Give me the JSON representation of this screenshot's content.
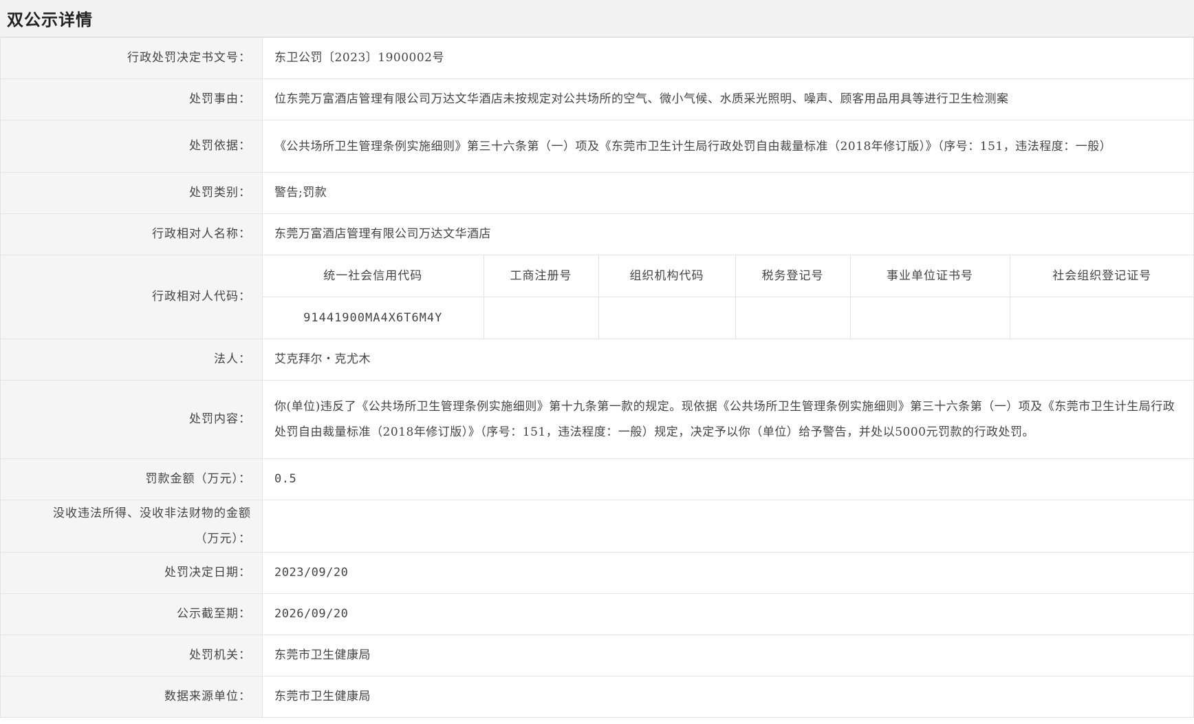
{
  "header": {
    "title": "双公示详情"
  },
  "rows": {
    "doc_no": {
      "label": "行政处罚决定书文号：",
      "value": "东卫公罚〔2023〕1900002号"
    },
    "reason": {
      "label": "处罚事由：",
      "value": "位东莞万富酒店管理有限公司万达文华酒店未按规定对公共场所的空气、微小气候、水质采光照明、噪声、顾客用品用具等进行卫生检测案"
    },
    "basis": {
      "label": "处罚依据：",
      "value": "《公共场所卫生管理条例实施细则》第三十六条第（一）项及《东莞市卫生计生局行政处罚自由裁量标准（2018年修订版）》（序号：151，违法程度：一般）"
    },
    "category": {
      "label": "处罚类别：",
      "value": "警告;罚款"
    },
    "party_name": {
      "label": "行政相对人名称：",
      "value": "东莞万富酒店管理有限公司万达文华酒店"
    },
    "party_code": {
      "label": "行政相对人代码：",
      "headers": [
        "统一社会信用代码",
        "工商注册号",
        "组织机构代码",
        "税务登记号",
        "事业单位证书号",
        "社会组织登记证号"
      ],
      "values": [
        "91441900MA4X6T6M4Y",
        "",
        "",
        "",
        "",
        ""
      ]
    },
    "legal_person": {
      "label": "法人：",
      "value": "艾克拜尔・克尤木"
    },
    "content": {
      "label": "处罚内容：",
      "value": "你(单位)违反了《公共场所卫生管理条例实施细则》第十九条第一款的规定。现依据《公共场所卫生管理条例实施细则》第三十六条第（一）项及《东莞市卫生计生局行政处罚自由裁量标准（2018年修订版）》（序号：151，违法程度：一般）规定，决定予以你（单位）给予警告，并处以5000元罚款的行政处罚。"
    },
    "fine": {
      "label": "罚款金额（万元）：",
      "value": "0.5"
    },
    "confiscation": {
      "label": "没收违法所得、没收非法财物的金额（万元）：",
      "value": ""
    },
    "decision_date": {
      "label": "处罚决定日期：",
      "value": "2023/09/20"
    },
    "publicity_end": {
      "label": "公示截至期：",
      "value": "2026/09/20"
    },
    "authority": {
      "label": "处罚机关：",
      "value": "东莞市卫生健康局"
    },
    "source": {
      "label": "数据来源单位：",
      "value": "东莞市卫生健康局"
    }
  }
}
